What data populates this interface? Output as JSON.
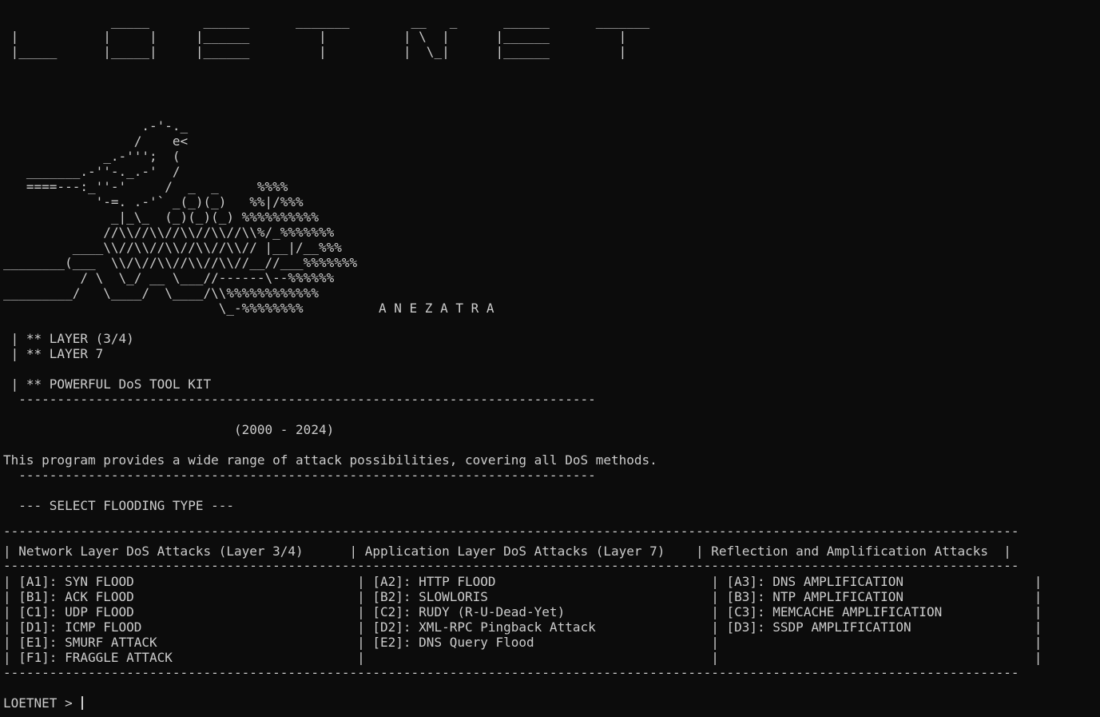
{
  "logo_lines": [
    "              _____       ______      _______        __   _      ______      _______",
    " |           |     |     |______         |          | \\  |      |______         |",
    " |_____      |_____|     |______         |          |  \\_|      |______         |"
  ],
  "art_lines": [
    "                  .-'-._",
    "                 /    e<",
    "             _.-''';  (",
    "   _______.-''-._.-'  /",
    "   ====---:_''-'     /  _  _     %%%%",
    "            '-=. .-'` _(_)(_)   %%|/%%%",
    "              _|_\\_  (_)(_)(_) %%%%%%%%%%",
    "             //\\\\//\\\\//\\\\//\\\\//\\\\%/_%%%%%%%",
    "         ____\\\\//\\\\//\\\\//\\\\//\\\\// |__|/__%%%",
    "________(___  \\\\/\\//\\\\//\\\\//\\\\//__//___%%%%%%%",
    "          / \\  \\_/ __ \\___//------\\--%%%%%%",
    "_________/   \\____/  \\____/\\\\%%%%%%%%%%%%",
    "                            \\_-%%%%%%%%"
  ],
  "author": "A N E Z A T R A",
  "info": {
    "layer34": " | ** LAYER (3/4)",
    "layer7": " | ** LAYER 7",
    "toolkit": " | ** POWERFUL DoS TOOL KIT",
    "rule": "  ---------------------------------------------------------------------------",
    "years": "                              (2000 - 2024)",
    "description": "This program provides a wide range of attack possibilities, covering all DoS methods.",
    "select_heading": "  --- SELECT FLOODING TYPE ---"
  },
  "menu": {
    "border": "------------------------------------------------------------------------------------------------------------------------------------",
    "header": "| Network Layer DoS Attacks (Layer 3/4)      | Application Layer DoS Attacks (Layer 7)    | Reflection and Amplification Attacks  |",
    "rows": [
      "| [A1]: SYN FLOOD                             | [A2]: HTTP FLOOD                            | [A3]: DNS AMPLIFICATION                 |",
      "| [B1]: ACK FLOOD                             | [B2]: SLOWLORIS                             | [B3]: NTP AMPLIFICATION                 |",
      "| [C1]: UDP FLOOD                             | [C2]: RUDY (R-U-Dead-Yet)                   | [C3]: MEMCACHE AMPLIFICATION            |",
      "| [D1]: ICMP FLOOD                            | [D2]: XML-RPC Pingback Attack               | [D3]: SSDP AMPLIFICATION                |",
      "| [E1]: SMURF ATTACK                          | [E2]: DNS Query Flood                       |                                         |",
      "| [F1]: FRAGGLE ATTACK                        |                                             |                                         |"
    ]
  },
  "prompt": "LOETNET > "
}
